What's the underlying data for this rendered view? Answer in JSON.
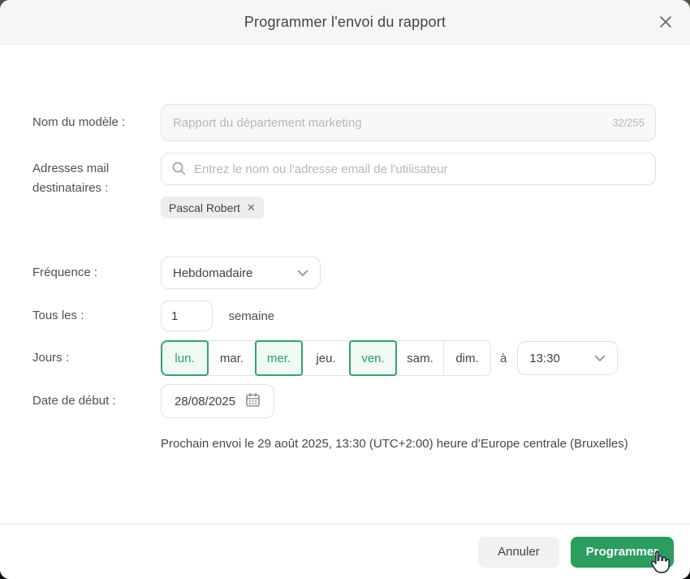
{
  "modal": {
    "title": "Programmer l'envoi du rapport"
  },
  "form": {
    "name": {
      "label": "Nom du modèle :",
      "value": "Rapport du département marketing",
      "counter": "32/255"
    },
    "recipients": {
      "label": "Adresses mail destinataires :",
      "placeholder": "Entrez le nom ou l'adresse email de l'utilisateur",
      "chips": [
        {
          "name": "Pascal Robert",
          "remove_label": "✕"
        }
      ]
    },
    "frequency": {
      "label": "Fréquence :",
      "value": "Hebdomadaire"
    },
    "interval": {
      "label": "Tous les :",
      "value": "1",
      "unit": "semaine"
    },
    "days": {
      "label": "Jours :",
      "items": [
        {
          "label": "lun.",
          "selected": true
        },
        {
          "label": "mar.",
          "selected": false
        },
        {
          "label": "mer.",
          "selected": true
        },
        {
          "label": "jeu.",
          "selected": false
        },
        {
          "label": "ven.",
          "selected": true
        },
        {
          "label": "sam.",
          "selected": false
        },
        {
          "label": "dim.",
          "selected": false
        }
      ],
      "at_label": "à",
      "time": "13:30"
    },
    "start_date": {
      "label": "Date de début :",
      "value": "28/08/2025"
    },
    "next_send_note": "Prochain envoi le 29 août 2025, 13:30 (UTC+2:00) heure d’Europe centrale (Bruxelles)"
  },
  "footer": {
    "cancel_label": "Annuler",
    "submit_label": "Programmer"
  },
  "colors": {
    "accent_green": "#2a9d5f",
    "selected_day_bg": "#f0faf4",
    "selected_day_border": "#34a566"
  }
}
